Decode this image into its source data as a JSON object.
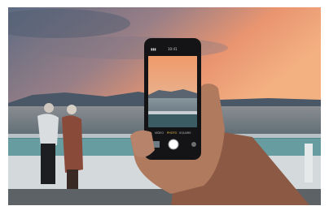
{
  "scene": {
    "description_icons": [
      "phone-icon",
      "camera-shutter-icon"
    ],
    "camera_app": {
      "status_left": "▮▮▮",
      "status_center": "10:41",
      "mode_labels": [
        "VIDEO",
        "PHOTO",
        "SQUARE"
      ],
      "active_mode": "PHOTO"
    },
    "colors": {
      "sky_top": "#5f6f86",
      "sky_glow": "#f2a070",
      "sea": "#6c7d86",
      "deck": "#d8dde0",
      "phone": "#141416",
      "skin": "#b07a5e"
    }
  }
}
